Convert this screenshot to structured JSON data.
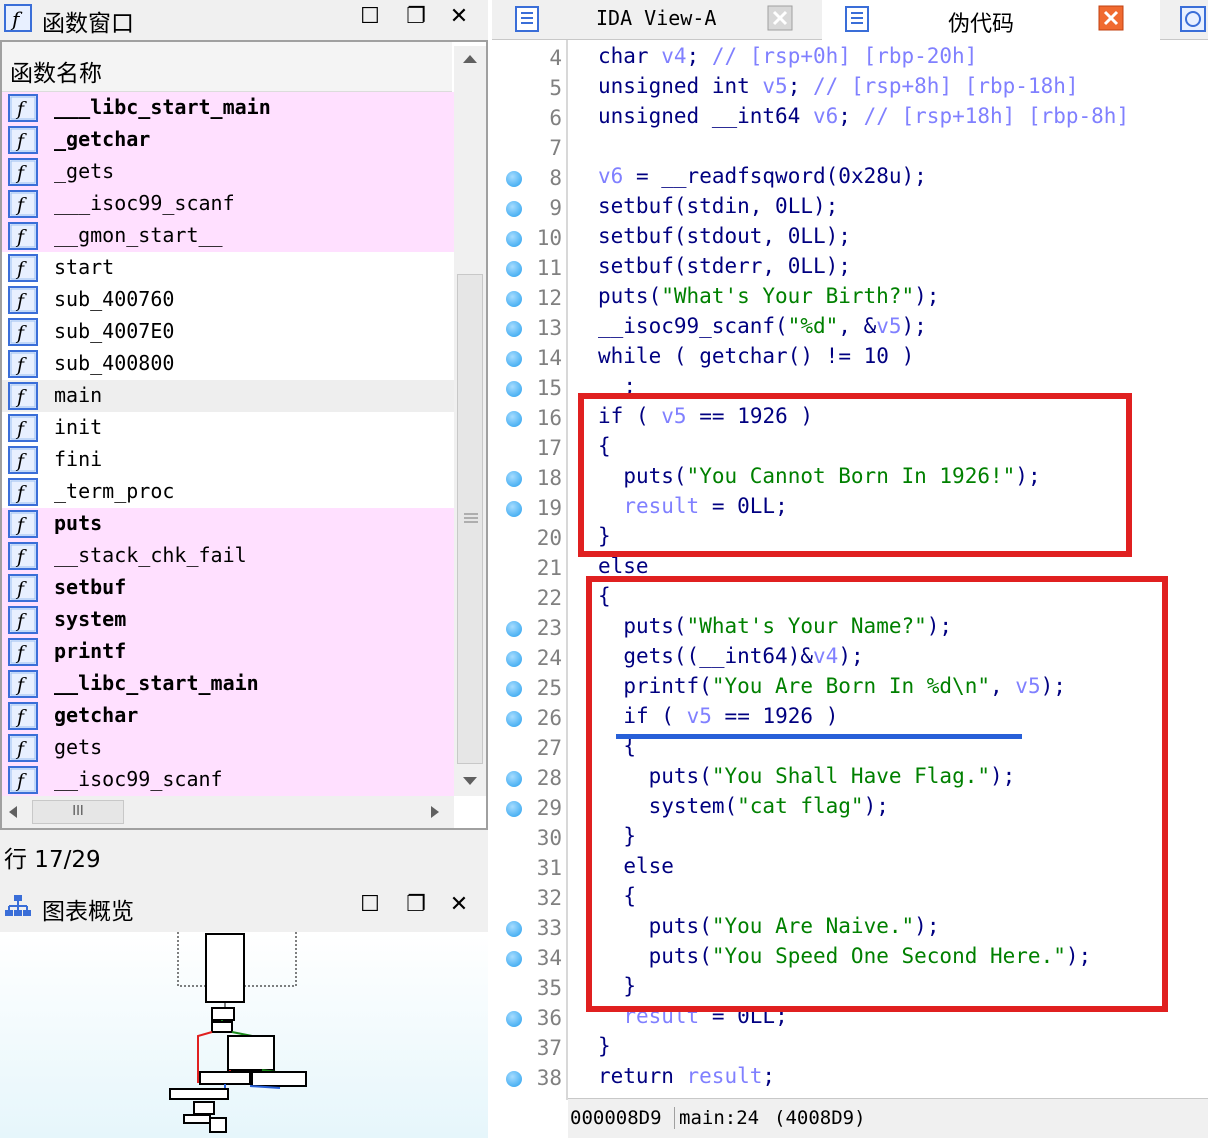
{
  "functions_window": {
    "title": "函数窗口",
    "column_header": "函数名称",
    "items": [
      {
        "name": "___libc_start_main",
        "style": "pink bold"
      },
      {
        "name": "_getchar",
        "style": "pink bold"
      },
      {
        "name": "_gets",
        "style": "pink"
      },
      {
        "name": "___isoc99_scanf",
        "style": "pink"
      },
      {
        "name": "__gmon_start__",
        "style": "pink"
      },
      {
        "name": "start",
        "style": ""
      },
      {
        "name": "sub_400760",
        "style": ""
      },
      {
        "name": "sub_4007E0",
        "style": ""
      },
      {
        "name": "sub_400800",
        "style": ""
      },
      {
        "name": "main",
        "style": "sel"
      },
      {
        "name": "init",
        "style": ""
      },
      {
        "name": "fini",
        "style": ""
      },
      {
        "name": "_term_proc",
        "style": ""
      },
      {
        "name": "puts",
        "style": "pink bold"
      },
      {
        "name": "__stack_chk_fail",
        "style": "pink"
      },
      {
        "name": "setbuf",
        "style": "pink bold"
      },
      {
        "name": "system",
        "style": "pink bold"
      },
      {
        "name": "printf",
        "style": "pink bold"
      },
      {
        "name": "__libc_start_main",
        "style": "pink bold"
      },
      {
        "name": "getchar",
        "style": "pink bold"
      },
      {
        "name": "gets",
        "style": "pink"
      },
      {
        "name": "__isoc99_scanf",
        "style": "pink"
      }
    ],
    "hscroll_thumb": "III",
    "line_status": "行 17/29"
  },
  "graph_overview": {
    "title": "图表概览"
  },
  "tabs": [
    {
      "label": "IDA View-A",
      "active": false
    },
    {
      "label": "伪代码",
      "active": true
    }
  ],
  "pseudocode": {
    "lines": [
      {
        "n": "4",
        "bp": false,
        "code": "char v4; // [rsp+0h] [rbp-20h]",
        "kind": "decl"
      },
      {
        "n": "5",
        "bp": false,
        "code": "unsigned int v5; // [rsp+8h] [rbp-18h]",
        "kind": "decl"
      },
      {
        "n": "6",
        "bp": false,
        "code": "unsigned __int64 v6; // [rsp+18h] [rbp-8h]",
        "kind": "decl"
      },
      {
        "n": "7",
        "bp": false,
        "code": "",
        "kind": "blank"
      },
      {
        "n": "8",
        "bp": true,
        "code": "v6 = __readfsqword(0x28u);",
        "kind": "code"
      },
      {
        "n": "9",
        "bp": true,
        "code": "setbuf(stdin, 0LL);",
        "kind": "code"
      },
      {
        "n": "10",
        "bp": true,
        "code": "setbuf(stdout, 0LL);",
        "kind": "code"
      },
      {
        "n": "11",
        "bp": true,
        "code": "setbuf(stderr, 0LL);",
        "kind": "code"
      },
      {
        "n": "12",
        "bp": true,
        "code": "puts(\"What's Your Birth?\");",
        "kind": "code"
      },
      {
        "n": "13",
        "bp": true,
        "code": "__isoc99_scanf(\"%d\", &v5);",
        "kind": "code"
      },
      {
        "n": "14",
        "bp": true,
        "code": "while ( getchar() != 10 )",
        "kind": "code"
      },
      {
        "n": "15",
        "bp": true,
        "code": "  ;",
        "kind": "code"
      },
      {
        "n": "16",
        "bp": true,
        "code": "if ( v5 == 1926 )",
        "kind": "code"
      },
      {
        "n": "17",
        "bp": false,
        "code": "{",
        "kind": "code"
      },
      {
        "n": "18",
        "bp": true,
        "code": "  puts(\"You Cannot Born In 1926!\");",
        "kind": "code"
      },
      {
        "n": "19",
        "bp": true,
        "code": "  result = 0LL;",
        "kind": "code"
      },
      {
        "n": "20",
        "bp": false,
        "code": "}",
        "kind": "code"
      },
      {
        "n": "21",
        "bp": false,
        "code": "else",
        "kind": "code"
      },
      {
        "n": "22",
        "bp": false,
        "code": "{",
        "kind": "code"
      },
      {
        "n": "23",
        "bp": true,
        "code": "  puts(\"What's Your Name?\");",
        "kind": "code"
      },
      {
        "n": "24",
        "bp": true,
        "code": "  gets((__int64)&v4);",
        "kind": "code"
      },
      {
        "n": "25",
        "bp": true,
        "code": "  printf(\"You Are Born In %d\\n\", v5);",
        "kind": "code"
      },
      {
        "n": "26",
        "bp": true,
        "code": "  if ( v5 == 1926 )",
        "kind": "code"
      },
      {
        "n": "27",
        "bp": false,
        "code": "  {",
        "kind": "code"
      },
      {
        "n": "28",
        "bp": true,
        "code": "    puts(\"You Shall Have Flag.\");",
        "kind": "code"
      },
      {
        "n": "29",
        "bp": true,
        "code": "    system(\"cat flag\");",
        "kind": "code"
      },
      {
        "n": "30",
        "bp": false,
        "code": "  }",
        "kind": "code"
      },
      {
        "n": "31",
        "bp": false,
        "code": "  else",
        "kind": "code"
      },
      {
        "n": "32",
        "bp": false,
        "code": "  {",
        "kind": "code"
      },
      {
        "n": "33",
        "bp": true,
        "code": "    puts(\"You Are Naive.\");",
        "kind": "code"
      },
      {
        "n": "34",
        "bp": true,
        "code": "    puts(\"You Speed One Second Here.\");",
        "kind": "code"
      },
      {
        "n": "35",
        "bp": false,
        "code": "  }",
        "kind": "code"
      },
      {
        "n": "36",
        "bp": true,
        "code": "  result = 0LL;",
        "kind": "code"
      },
      {
        "n": "37",
        "bp": false,
        "code": "}",
        "kind": "code"
      },
      {
        "n": "38",
        "bp": true,
        "code": "return result;",
        "kind": "code"
      }
    ]
  },
  "status_bar": {
    "address": "000008D9",
    "location": "main:24",
    "ea": "(4008D9)"
  },
  "colors": {
    "keyword_type": "#000080",
    "variable": "#8080ff",
    "comment": "#8080ff",
    "string": "#008000",
    "number": "#000080",
    "annotation_red": "#e02020",
    "annotation_blue": "#2860d8",
    "imported_function_bg": "#ffe0ff"
  }
}
